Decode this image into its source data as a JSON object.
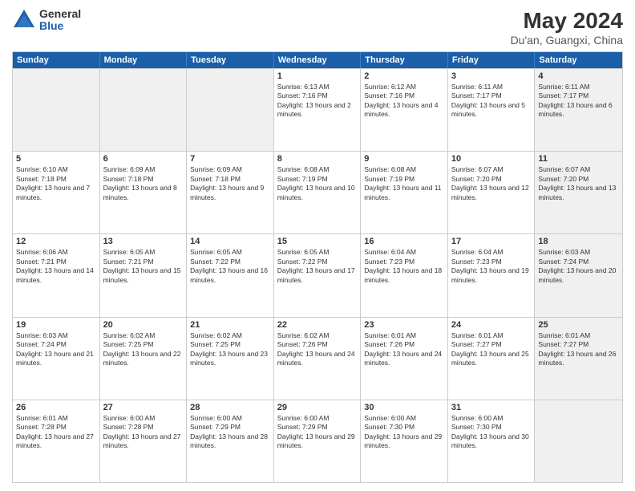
{
  "header": {
    "logo_general": "General",
    "logo_blue": "Blue",
    "title": "May 2024",
    "subtitle": "Du'an, Guangxi, China"
  },
  "days_of_week": [
    "Sunday",
    "Monday",
    "Tuesday",
    "Wednesday",
    "Thursday",
    "Friday",
    "Saturday"
  ],
  "weeks": [
    [
      {
        "day": "",
        "text": "",
        "shaded": true
      },
      {
        "day": "",
        "text": "",
        "shaded": true
      },
      {
        "day": "",
        "text": "",
        "shaded": true
      },
      {
        "day": "1",
        "text": "Sunrise: 6:13 AM\nSunset: 7:16 PM\nDaylight: 13 hours and 2 minutes.",
        "shaded": false
      },
      {
        "day": "2",
        "text": "Sunrise: 6:12 AM\nSunset: 7:16 PM\nDaylight: 13 hours and 4 minutes.",
        "shaded": false
      },
      {
        "day": "3",
        "text": "Sunrise: 6:11 AM\nSunset: 7:17 PM\nDaylight: 13 hours and 5 minutes.",
        "shaded": false
      },
      {
        "day": "4",
        "text": "Sunrise: 6:11 AM\nSunset: 7:17 PM\nDaylight: 13 hours and 6 minutes.",
        "shaded": true
      }
    ],
    [
      {
        "day": "5",
        "text": "Sunrise: 6:10 AM\nSunset: 7:18 PM\nDaylight: 13 hours and 7 minutes.",
        "shaded": false
      },
      {
        "day": "6",
        "text": "Sunrise: 6:09 AM\nSunset: 7:18 PM\nDaylight: 13 hours and 8 minutes.",
        "shaded": false
      },
      {
        "day": "7",
        "text": "Sunrise: 6:09 AM\nSunset: 7:18 PM\nDaylight: 13 hours and 9 minutes.",
        "shaded": false
      },
      {
        "day": "8",
        "text": "Sunrise: 6:08 AM\nSunset: 7:19 PM\nDaylight: 13 hours and 10 minutes.",
        "shaded": false
      },
      {
        "day": "9",
        "text": "Sunrise: 6:08 AM\nSunset: 7:19 PM\nDaylight: 13 hours and 11 minutes.",
        "shaded": false
      },
      {
        "day": "10",
        "text": "Sunrise: 6:07 AM\nSunset: 7:20 PM\nDaylight: 13 hours and 12 minutes.",
        "shaded": false
      },
      {
        "day": "11",
        "text": "Sunrise: 6:07 AM\nSunset: 7:20 PM\nDaylight: 13 hours and 13 minutes.",
        "shaded": true
      }
    ],
    [
      {
        "day": "12",
        "text": "Sunrise: 6:06 AM\nSunset: 7:21 PM\nDaylight: 13 hours and 14 minutes.",
        "shaded": false
      },
      {
        "day": "13",
        "text": "Sunrise: 6:05 AM\nSunset: 7:21 PM\nDaylight: 13 hours and 15 minutes.",
        "shaded": false
      },
      {
        "day": "14",
        "text": "Sunrise: 6:05 AM\nSunset: 7:22 PM\nDaylight: 13 hours and 16 minutes.",
        "shaded": false
      },
      {
        "day": "15",
        "text": "Sunrise: 6:05 AM\nSunset: 7:22 PM\nDaylight: 13 hours and 17 minutes.",
        "shaded": false
      },
      {
        "day": "16",
        "text": "Sunrise: 6:04 AM\nSunset: 7:23 PM\nDaylight: 13 hours and 18 minutes.",
        "shaded": false
      },
      {
        "day": "17",
        "text": "Sunrise: 6:04 AM\nSunset: 7:23 PM\nDaylight: 13 hours and 19 minutes.",
        "shaded": false
      },
      {
        "day": "18",
        "text": "Sunrise: 6:03 AM\nSunset: 7:24 PM\nDaylight: 13 hours and 20 minutes.",
        "shaded": true
      }
    ],
    [
      {
        "day": "19",
        "text": "Sunrise: 6:03 AM\nSunset: 7:24 PM\nDaylight: 13 hours and 21 minutes.",
        "shaded": false
      },
      {
        "day": "20",
        "text": "Sunrise: 6:02 AM\nSunset: 7:25 PM\nDaylight: 13 hours and 22 minutes.",
        "shaded": false
      },
      {
        "day": "21",
        "text": "Sunrise: 6:02 AM\nSunset: 7:25 PM\nDaylight: 13 hours and 23 minutes.",
        "shaded": false
      },
      {
        "day": "22",
        "text": "Sunrise: 6:02 AM\nSunset: 7:26 PM\nDaylight: 13 hours and 24 minutes.",
        "shaded": false
      },
      {
        "day": "23",
        "text": "Sunrise: 6:01 AM\nSunset: 7:26 PM\nDaylight: 13 hours and 24 minutes.",
        "shaded": false
      },
      {
        "day": "24",
        "text": "Sunrise: 6:01 AM\nSunset: 7:27 PM\nDaylight: 13 hours and 25 minutes.",
        "shaded": false
      },
      {
        "day": "25",
        "text": "Sunrise: 6:01 AM\nSunset: 7:27 PM\nDaylight: 13 hours and 26 minutes.",
        "shaded": true
      }
    ],
    [
      {
        "day": "26",
        "text": "Sunrise: 6:01 AM\nSunset: 7:28 PM\nDaylight: 13 hours and 27 minutes.",
        "shaded": false
      },
      {
        "day": "27",
        "text": "Sunrise: 6:00 AM\nSunset: 7:28 PM\nDaylight: 13 hours and 27 minutes.",
        "shaded": false
      },
      {
        "day": "28",
        "text": "Sunrise: 6:00 AM\nSunset: 7:29 PM\nDaylight: 13 hours and 28 minutes.",
        "shaded": false
      },
      {
        "day": "29",
        "text": "Sunrise: 6:00 AM\nSunset: 7:29 PM\nDaylight: 13 hours and 29 minutes.",
        "shaded": false
      },
      {
        "day": "30",
        "text": "Sunrise: 6:00 AM\nSunset: 7:30 PM\nDaylight: 13 hours and 29 minutes.",
        "shaded": false
      },
      {
        "day": "31",
        "text": "Sunrise: 6:00 AM\nSunset: 7:30 PM\nDaylight: 13 hours and 30 minutes.",
        "shaded": false
      },
      {
        "day": "",
        "text": "",
        "shaded": true
      }
    ]
  ]
}
